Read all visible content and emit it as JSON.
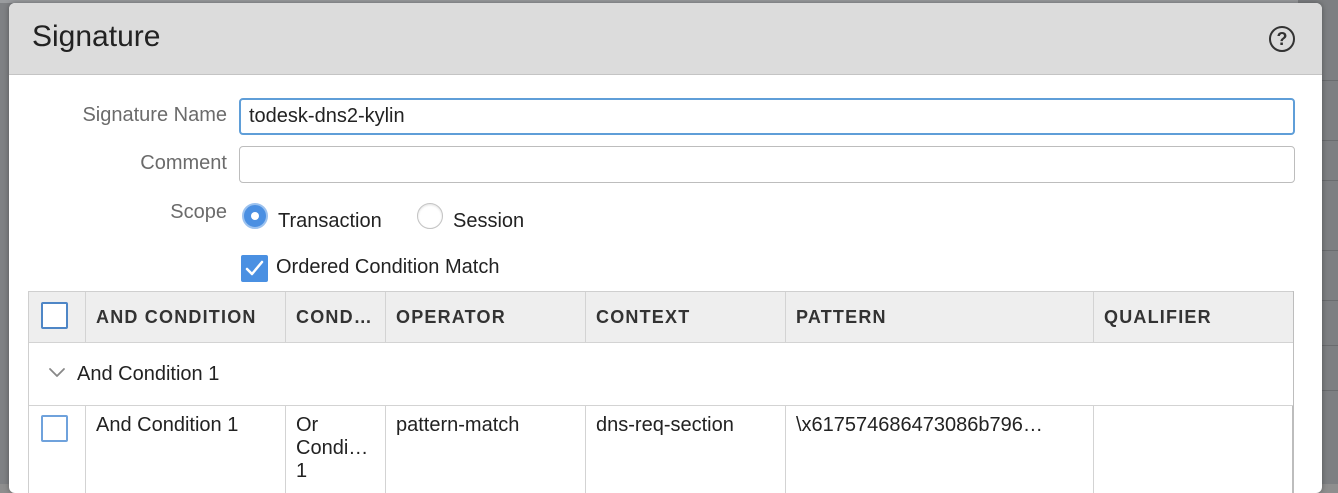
{
  "dialog": {
    "title": "Signature",
    "help_glyph": "?"
  },
  "form": {
    "signature_name_label": "Signature Name",
    "signature_name_value": "todesk-dns2-kylin",
    "comment_label": "Comment",
    "comment_value": "",
    "scope_label": "Scope",
    "scope_options": [
      "Transaction",
      "Session"
    ],
    "scope_selected": "Transaction",
    "ordered_match_label": "Ordered Condition Match",
    "ordered_match_checked": true
  },
  "table": {
    "columns": [
      "",
      "AND CONDITION",
      "COND…",
      "OPERATOR",
      "CONTEXT",
      "PATTERN",
      "QUALIFIER"
    ],
    "group_label": "And Condition 1",
    "rows": [
      {
        "and_condition": "And Condition 1",
        "condition_lines": [
          "Or",
          "Condi…",
          "1"
        ],
        "operator": "pattern-match",
        "context": "dns-req-section",
        "pattern": "\\x617574686473086b796…",
        "qualifier": ""
      }
    ]
  },
  "icons": {
    "help": "help-circle-icon",
    "checkmark": "checkmark-icon",
    "expand": "chevron-down-icon"
  },
  "colors": {
    "accent": "#4a90e2",
    "focus_border": "#5f9ed8",
    "header_bg": "#dcdcdc",
    "table_header_bg": "#eeeeee"
  }
}
